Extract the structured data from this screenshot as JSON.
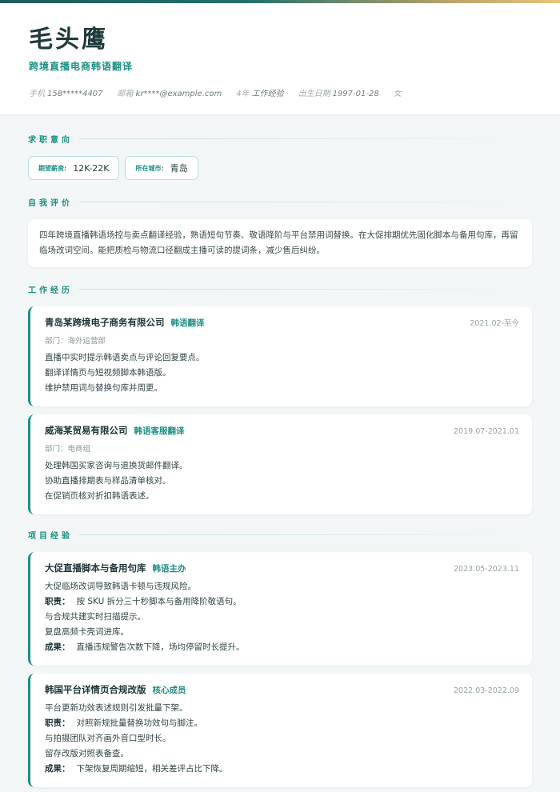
{
  "profile": {
    "name": "毛头鹰",
    "headline": "跨境直播电商韩语翻译",
    "phone_label": "手机",
    "phone": "158*****4407",
    "email_label": "邮箱",
    "email": "kr****@example.com",
    "years_label": "4年",
    "years": "工作经验",
    "birth_label": "出生日期",
    "birth": "1997-01-28",
    "gender": "女"
  },
  "sections": {
    "intent": "求职意向",
    "summary": "自我评价",
    "work": "工作经历",
    "projects": "项目经验"
  },
  "intent": {
    "salary_label": "期望薪资:",
    "salary": "12K-22K",
    "city_label": "所在城市:",
    "city": "青岛"
  },
  "summary": "四年跨境直播韩语场控与卖点翻译经验，熟语短句节奏、敬语降阶与平台禁用词替换。在大促排期优先固化脚本与备用句库，再留临场改词空间。能把质检与物流口径翻成主播可读的提词条，减少售后纠纷。",
  "work": [
    {
      "company": "青岛某跨境电子商务有限公司",
      "role": "韩语翻译",
      "date": "2021.02-至今",
      "dept": "部门：海外运营部",
      "lines": [
        "直播中实时提示韩语卖点与评论回复要点。",
        "翻译详情页与短视频脚本韩语版。",
        "维护禁用词与替换句库并周更。"
      ]
    },
    {
      "company": "威海某贸易有限公司",
      "role": "韩语客服翻译",
      "date": "2019.07-2021.01",
      "dept": "部门：电商组",
      "lines": [
        "处理韩国买家咨询与退换货邮件翻译。",
        "协助直播排期表与样品清单核对。",
        "在促销页核对折扣韩语表述。"
      ]
    }
  ],
  "projects": [
    {
      "name": "大促直播脚本与备用句库",
      "role": "韩语主办",
      "date": "2023.05-2023.11",
      "background": "大促临场改词导致韩语卡顿与违规风险。",
      "duty_label": "职责：",
      "duty": "按 SKU 拆分三十秒脚本与备用降阶敬语句。",
      "extra": [
        "与合规共建实时扫描提示。",
        "复盘高频卡壳词进库。"
      ],
      "result_label": "成果：",
      "result": "直播违规警告次数下降，场均停留时长提升。"
    },
    {
      "name": "韩国平台详情页合规改版",
      "role": "核心成员",
      "date": "2022.03-2022.09",
      "background": "平台更新功效表述规则引发批量下架。",
      "duty_label": "职责：",
      "duty": "对照新规批量替换功效句与脚注。",
      "extra": [
        "与拍摄团队对齐画外音口型时长。",
        "留存改版对照表备查。"
      ],
      "result_label": "成果：",
      "result": "下架恢复周期缩短，相关差评占比下降。"
    }
  ]
}
